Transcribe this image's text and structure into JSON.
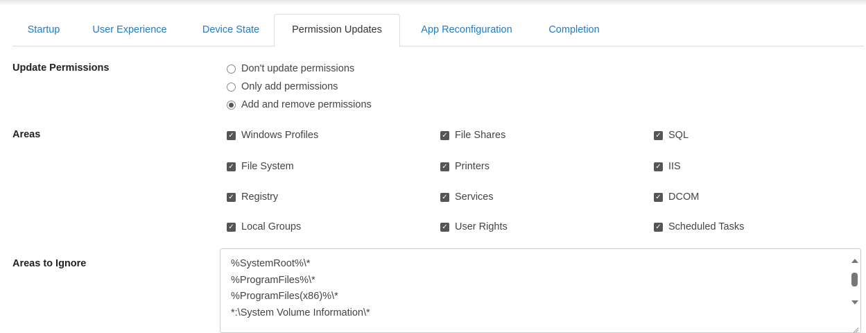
{
  "tabs": [
    {
      "label": "Startup"
    },
    {
      "label": "User Experience"
    },
    {
      "label": "Device State"
    },
    {
      "label": "Permission Updates",
      "active": true
    },
    {
      "label": "App Reconfiguration"
    },
    {
      "label": "Completion"
    }
  ],
  "update_permissions": {
    "label": "Update Permissions",
    "options": [
      {
        "label": "Don't update permissions",
        "selected": false
      },
      {
        "label": "Only add permissions",
        "selected": false
      },
      {
        "label": "Add and remove permissions",
        "selected": true
      }
    ]
  },
  "areas": {
    "label": "Areas",
    "items": [
      {
        "label": "Windows Profiles",
        "checked": true
      },
      {
        "label": "File Shares",
        "checked": true
      },
      {
        "label": "SQL",
        "checked": true
      },
      {
        "label": "File System",
        "checked": true
      },
      {
        "label": "Printers",
        "checked": true
      },
      {
        "label": "IIS",
        "checked": true
      },
      {
        "label": "Registry",
        "checked": true
      },
      {
        "label": "Services",
        "checked": true
      },
      {
        "label": "DCOM",
        "checked": true
      },
      {
        "label": "Local Groups",
        "checked": true
      },
      {
        "label": "User Rights",
        "checked": true
      },
      {
        "label": "Scheduled Tasks",
        "checked": true
      }
    ]
  },
  "areas_to_ignore": {
    "label": "Areas to Ignore",
    "lines": [
      "%SystemRoot%\\*",
      "%ProgramFiles%\\*",
      "%ProgramFiles(x86)%\\*",
      "*:\\System Volume Information\\*"
    ]
  },
  "icons": {
    "checkbox_checked": "checkbox-checked-icon",
    "radio_selected": "radio-selected-icon",
    "scroll_up": "scroll-up-arrow-icon",
    "scroll_down": "scroll-down-arrow-icon",
    "resize": "resize-grip-icon"
  },
  "colors": {
    "tab_link": "#1a7bd6",
    "checkbox": "#555555"
  }
}
